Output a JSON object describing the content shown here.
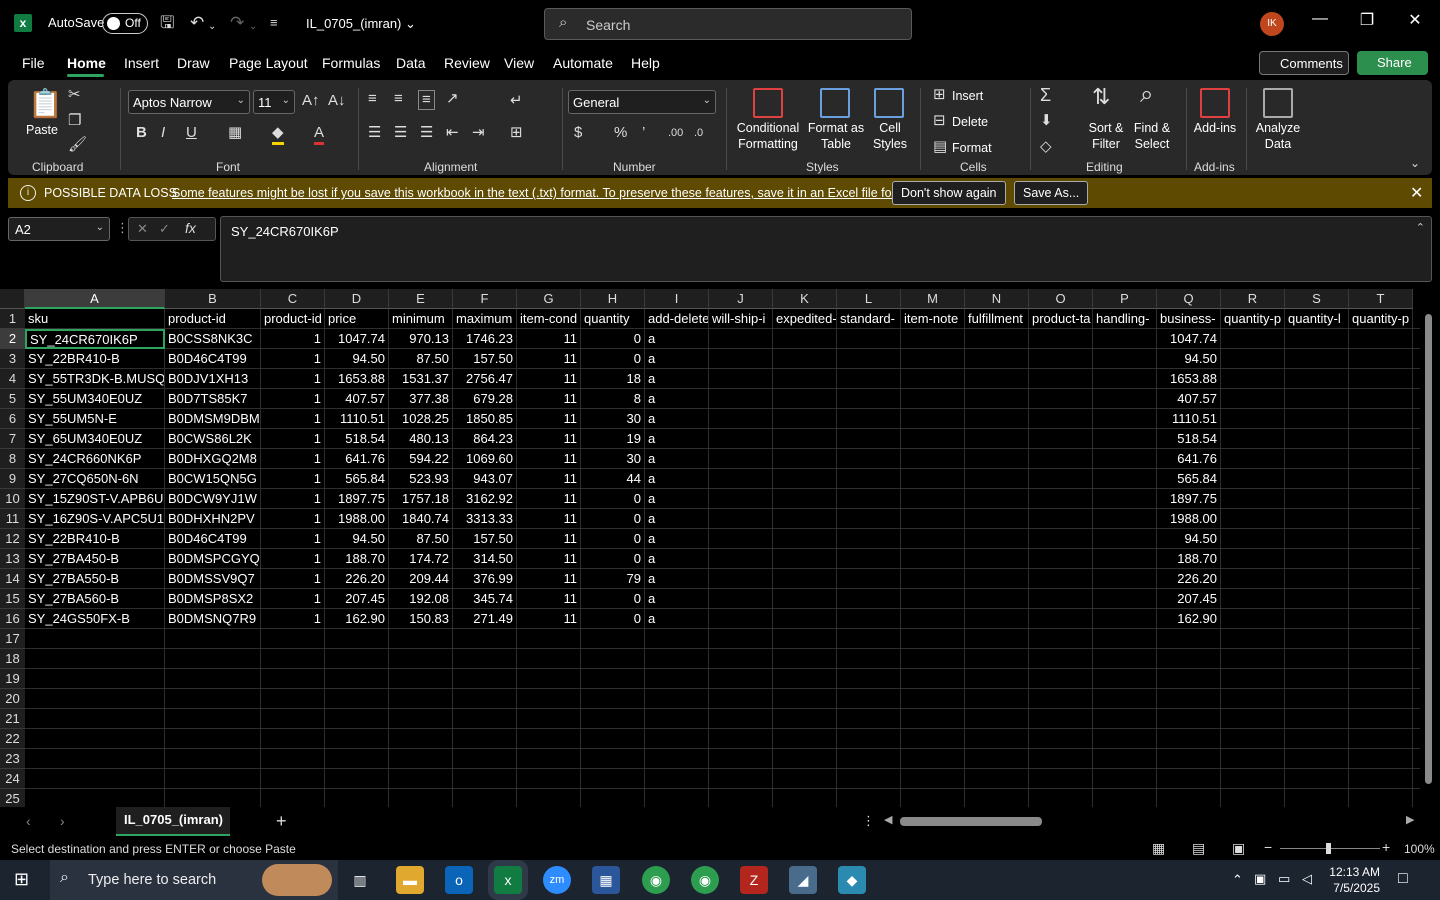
{
  "titlebar": {
    "autosave_label": "AutoSave",
    "autosave_state": "Off",
    "filename": "IL_0705_(imran)",
    "search_placeholder": "Search",
    "avatar_initials": "IK"
  },
  "tabs": [
    "File",
    "Home",
    "Insert",
    "Draw",
    "Page Layout",
    "Formulas",
    "Data",
    "Review",
    "View",
    "Automate",
    "Help"
  ],
  "actions": {
    "comments": "Comments",
    "share": "Share"
  },
  "ribbon": {
    "clipboard": {
      "label": "Clipboard",
      "paste": "Paste"
    },
    "font": {
      "label": "Font",
      "name": "Aptos Narrow",
      "size": "11",
      "bold": "B",
      "italic": "I",
      "underline": "U"
    },
    "alignment": {
      "label": "Alignment"
    },
    "number": {
      "label": "Number",
      "format": "General"
    },
    "styles": {
      "label": "Styles",
      "conditional": "Conditional",
      "formatting": "Formatting",
      "format_as": "Format as",
      "table": "Table",
      "cell": "Cell",
      "cell_styles": "Styles"
    },
    "cells": {
      "label": "Cells",
      "insert": "Insert",
      "delete": "Delete",
      "format": "Format"
    },
    "editing": {
      "label": "Editing",
      "sort": "Sort &",
      "filter": "Filter",
      "find": "Find &",
      "select": "Select"
    },
    "addins": {
      "label": "Add-ins",
      "addins": "Add-ins",
      "analyze": "Analyze",
      "data": "Data"
    }
  },
  "warning": {
    "title": "POSSIBLE DATA LOSS",
    "message": "Some features might be lost if you save this workbook in the text (.txt) format. To preserve these features, save it in an Excel file format.",
    "dont_show": "Don't show again",
    "save_as": "Save As..."
  },
  "formula_bar": {
    "name_box": "A2",
    "formula": "SY_24CR670IK6P"
  },
  "grid": {
    "columns": [
      "A",
      "B",
      "C",
      "D",
      "E",
      "F",
      "G",
      "H",
      "I",
      "J",
      "K",
      "L",
      "M",
      "N",
      "O",
      "P",
      "Q",
      "R",
      "S",
      "T"
    ],
    "header_row": [
      "sku",
      "product-id",
      "product-id",
      "price",
      "minimum",
      "maximum",
      "item-cond",
      "quantity",
      "add-delete",
      "will-ship-i",
      "expedited-",
      "standard-",
      "item-note",
      "fulfillment",
      "product-ta",
      "handling-",
      "business-",
      "quantity-p",
      "quantity-l",
      "quantity-p"
    ],
    "rows": [
      [
        "SY_24CR670IK6P",
        "B0CSS8NK3C",
        "1",
        "1047.74",
        "970.13",
        "1746.23",
        "11",
        "0",
        "a",
        "1047.74"
      ],
      [
        "SY_22BR410-B",
        "B0D46C4T99",
        "1",
        "94.50",
        "87.50",
        "157.50",
        "11",
        "0",
        "a",
        "94.50"
      ],
      [
        "SY_55TR3DK-B.MUSQ",
        "B0DJV1XH13",
        "1",
        "1653.88",
        "1531.37",
        "2756.47",
        "11",
        "18",
        "a",
        "1653.88"
      ],
      [
        "SY_55UM340E0UZ",
        "B0D7TS85K7",
        "1",
        "407.57",
        "377.38",
        "679.28",
        "11",
        "8",
        "a",
        "407.57"
      ],
      [
        "SY_55UM5N-E",
        "B0DMSM9DBM",
        "1",
        "1110.51",
        "1028.25",
        "1850.85",
        "11",
        "30",
        "a",
        "1110.51"
      ],
      [
        "SY_65UM340E0UZ",
        "B0CWS86L2K",
        "1",
        "518.54",
        "480.13",
        "864.23",
        "11",
        "19",
        "a",
        "518.54"
      ],
      [
        "SY_24CR660NK6P",
        "B0DHXGQ2M8",
        "1",
        "641.76",
        "594.22",
        "1069.60",
        "11",
        "30",
        "a",
        "641.76"
      ],
      [
        "SY_27CQ650N-6N",
        "B0CW15QN5G",
        "1",
        "565.84",
        "523.93",
        "943.07",
        "11",
        "44",
        "a",
        "565.84"
      ],
      [
        "SY_15Z90ST-V.APB6U1",
        "B0DCW9YJ1W",
        "1",
        "1897.75",
        "1757.18",
        "3162.92",
        "11",
        "0",
        "a",
        "1897.75"
      ],
      [
        "SY_16Z90S-V.APC5U1",
        "B0DHXHN2PV",
        "1",
        "1988.00",
        "1840.74",
        "3313.33",
        "11",
        "0",
        "a",
        "1988.00"
      ],
      [
        "SY_22BR410-B",
        "B0D46C4T99",
        "1",
        "94.50",
        "87.50",
        "157.50",
        "11",
        "0",
        "a",
        "94.50"
      ],
      [
        "SY_27BA450-B",
        "B0DMSPCGYQ",
        "1",
        "188.70",
        "174.72",
        "314.50",
        "11",
        "0",
        "a",
        "188.70"
      ],
      [
        "SY_27BA550-B",
        "B0DMSSV9Q7",
        "1",
        "226.20",
        "209.44",
        "376.99",
        "11",
        "79",
        "a",
        "226.20"
      ],
      [
        "SY_27BA560-B",
        "B0DMSP8SX2",
        "1",
        "207.45",
        "192.08",
        "345.74",
        "11",
        "0",
        "a",
        "207.45"
      ],
      [
        "SY_24GS50FX-B",
        "B0DMSNQ7R9",
        "1",
        "162.90",
        "150.83",
        "271.49",
        "11",
        "0",
        "a",
        "162.90"
      ]
    ],
    "row_numbers": [
      "1",
      "2",
      "3",
      "4",
      "5",
      "6",
      "7",
      "8",
      "9",
      "10",
      "11",
      "12",
      "13",
      "14",
      "15",
      "16",
      "17",
      "18",
      "19",
      "20",
      "21",
      "22",
      "23",
      "24",
      "25"
    ]
  },
  "sheet_tab": "IL_0705_(imran)",
  "status": {
    "message": "Select destination and press ENTER or choose Paste",
    "zoom": "100%"
  },
  "taskbar": {
    "search": "Type here to search",
    "time": "12:13 AM",
    "date": "7/5/2025"
  }
}
